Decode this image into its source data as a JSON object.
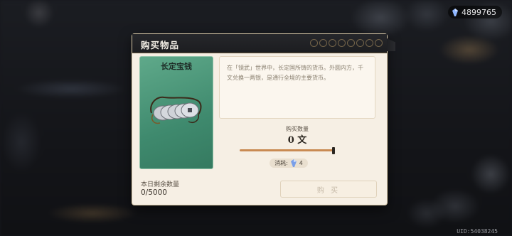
{
  "currency": {
    "icon": "gem-icon",
    "amount": "4899765"
  },
  "dialog": {
    "title": "购买物品",
    "item": {
      "name": "长定宝钱",
      "image": "coin-string-icon",
      "description": "在「镜武」世界中，长定国所铸的货币。外圆内方，千文兑换一两银，是通行全境的主要货币。"
    },
    "purchase": {
      "label": "购买数量",
      "quantity": "0 文",
      "slider_fraction": 1.0,
      "cost_label": "消耗:",
      "cost_icon": "gem-icon",
      "cost_value": "4"
    },
    "daily_remaining": {
      "label": "本日剩余数量",
      "value": "0/5000"
    },
    "buy_button": "购 买"
  },
  "uid": "UID:54038245"
}
